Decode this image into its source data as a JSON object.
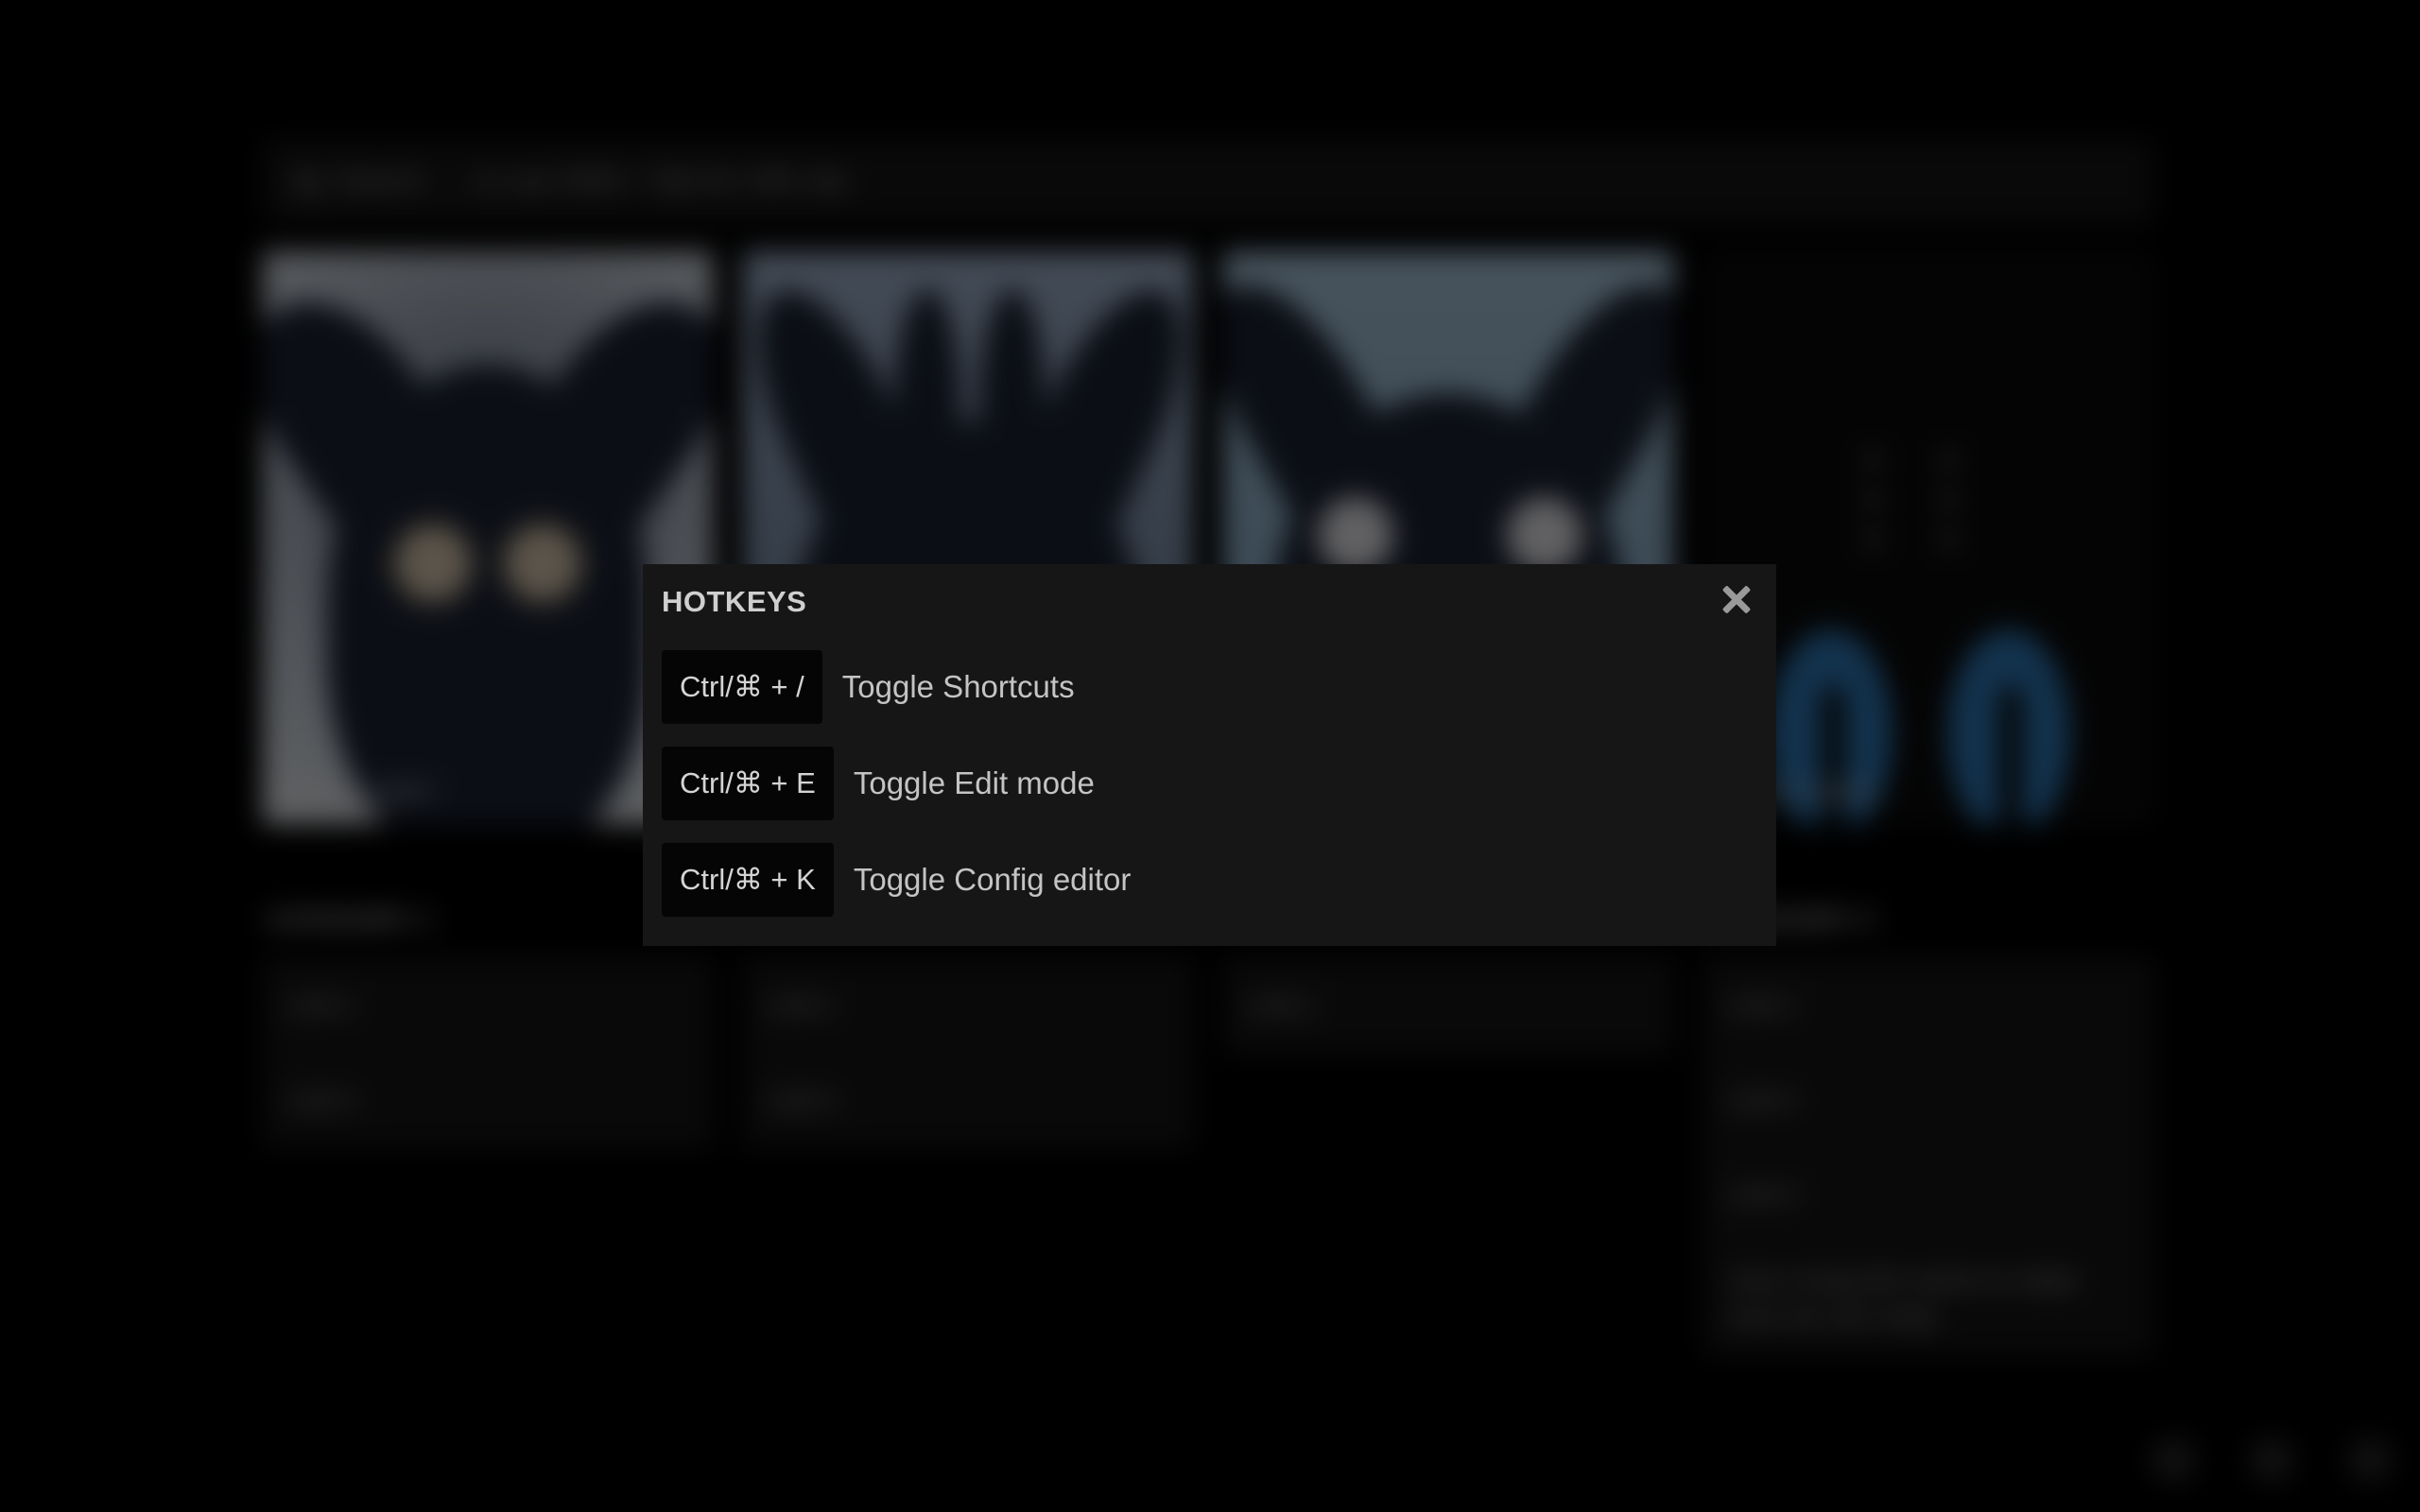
{
  "search": {
    "label": "Search",
    "hint": "... or use Shift + Tab for URL bar"
  },
  "tiles": [
    {
      "caption": "Image 1 caption"
    },
    {
      "caption": ""
    },
    {
      "caption": ""
    },
    {
      "caption": "Image 4 caption"
    }
  ],
  "categories": [
    {
      "title": "CATEGORY 1",
      "links": [
        "Link 1",
        "Link 2"
      ]
    },
    {
      "title": "",
      "links": [
        "Link 1",
        "Link 2"
      ]
    },
    {
      "title": "",
      "links": [
        "Link 1"
      ]
    },
    {
      "title": "CATEGORY 4",
      "links": [
        "Link 1",
        "Link 2",
        "Link 3",
        "Just a long link name to make sure we can wrap"
      ]
    }
  ],
  "corner_icons": [
    "history-icon",
    "edit-icon",
    "settings-icon"
  ],
  "modal": {
    "title": "HOTKEYS",
    "close_icon": "close-icon",
    "hotkeys": [
      {
        "keys": "Ctrl/⌘ + /",
        "action": "Toggle Shortcuts"
      },
      {
        "keys": "Ctrl/⌘ + E",
        "action": "Toggle Edit mode"
      },
      {
        "keys": "Ctrl/⌘ + K",
        "action": "Toggle Config editor"
      }
    ]
  },
  "colors": {
    "background": "#000000",
    "modal_bg": "#161616",
    "key_bg": "#050505",
    "text": "#c4c4c4",
    "accent_blue": "#2d78b8"
  }
}
